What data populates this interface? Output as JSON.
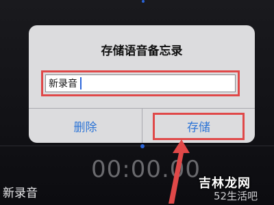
{
  "dialog": {
    "title": "存储语音备忘录",
    "input_value": "新录音",
    "buttons": {
      "delete": "删除",
      "save": "存储"
    }
  },
  "background": {
    "time": "00:00.00",
    "recording_name": "新录音"
  },
  "watermark": {
    "site_name": "吉林龙网",
    "site_sub": "52生活吧"
  },
  "colors": {
    "accent": "#2c74d6",
    "annotation": "#e04848",
    "dialog_bg": "#dcdcde"
  }
}
